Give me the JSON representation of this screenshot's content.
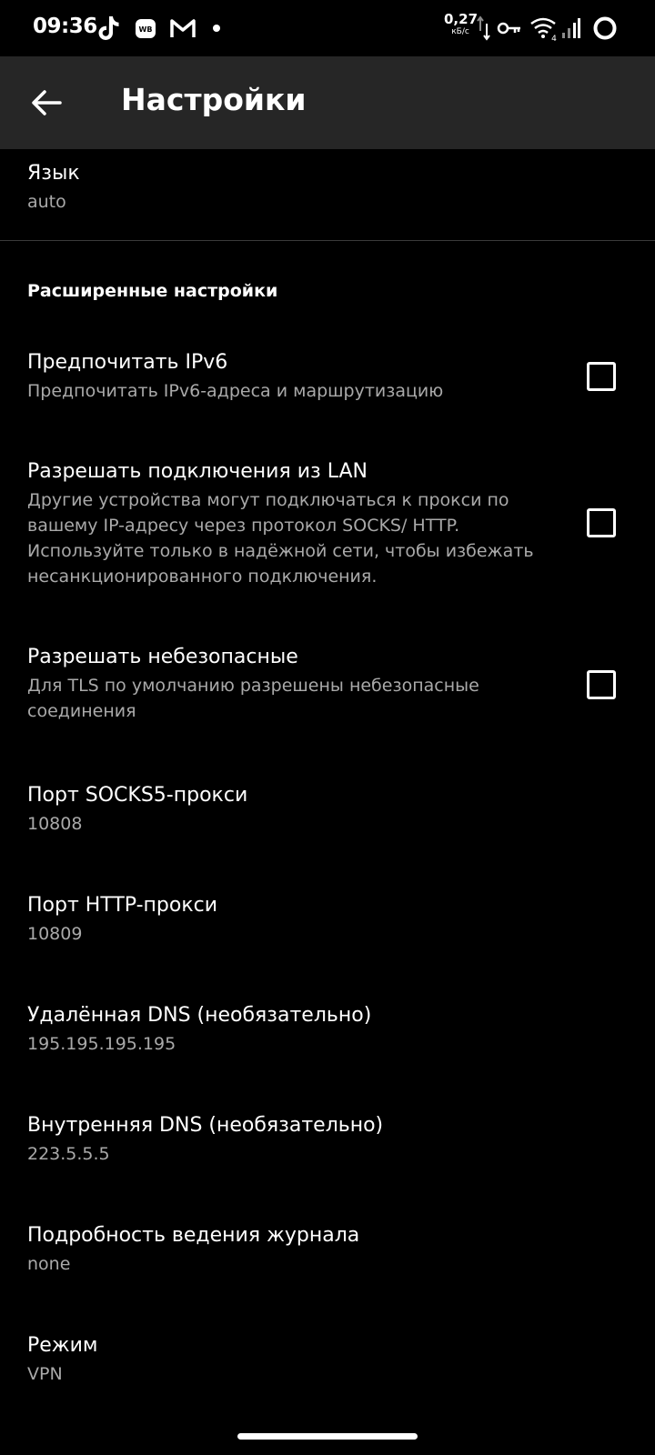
{
  "status_bar": {
    "time": "09:36",
    "net_speed_value": "0,27",
    "net_speed_unit": "кБ/с",
    "icons": [
      "tiktok-icon",
      "wb-icon",
      "gmail-icon",
      "dot-icon",
      "data-arrows-icon",
      "vpn-key-icon",
      "wifi-icon",
      "signal-icon",
      "battery-ring-icon"
    ],
    "wifi_badge": "4"
  },
  "app_bar": {
    "title": "Настройки",
    "back_icon": "arrow-back-icon"
  },
  "language": {
    "title": "Язык",
    "value": "auto"
  },
  "advanced": {
    "header": "Расширенные настройки",
    "prefer_ipv6": {
      "title": "Предпочитать IPv6",
      "summary": "Предпочитать IPv6-адреса и маршрутизацию",
      "checked": false
    },
    "allow_lan": {
      "title": "Разрешать подключения из LAN",
      "summary": "Другие устройства могут подключаться к прокси по вашему IP-адресу через протокол SOCKS/ HTTP. Используйте только в надёжной сети, чтобы избежать несанкционированного подключения.",
      "checked": false
    },
    "allow_insecure": {
      "title": "Разрешать небезопасные",
      "summary": "Для TLS по умолчанию разрешены небезопасные соединения",
      "checked": false
    },
    "socks_port": {
      "title": "Порт SOCKS5-прокси",
      "value": "10808"
    },
    "http_port": {
      "title": "Порт HTTP-прокси",
      "value": "10809"
    },
    "remote_dns": {
      "title": "Удалённая DNS (необязательно)",
      "value": "195.195.195.195"
    },
    "domestic_dns": {
      "title": "Внутренняя DNS (необязательно)",
      "value": "223.5.5.5"
    },
    "log_level": {
      "title": "Подробность ведения журнала",
      "value": "none"
    },
    "mode": {
      "title": "Режим",
      "value": "VPN"
    }
  },
  "colors": {
    "background": "#000000",
    "app_bar": "#262626",
    "text_primary": "#ffffff",
    "text_secondary": "#a9a9a9"
  }
}
